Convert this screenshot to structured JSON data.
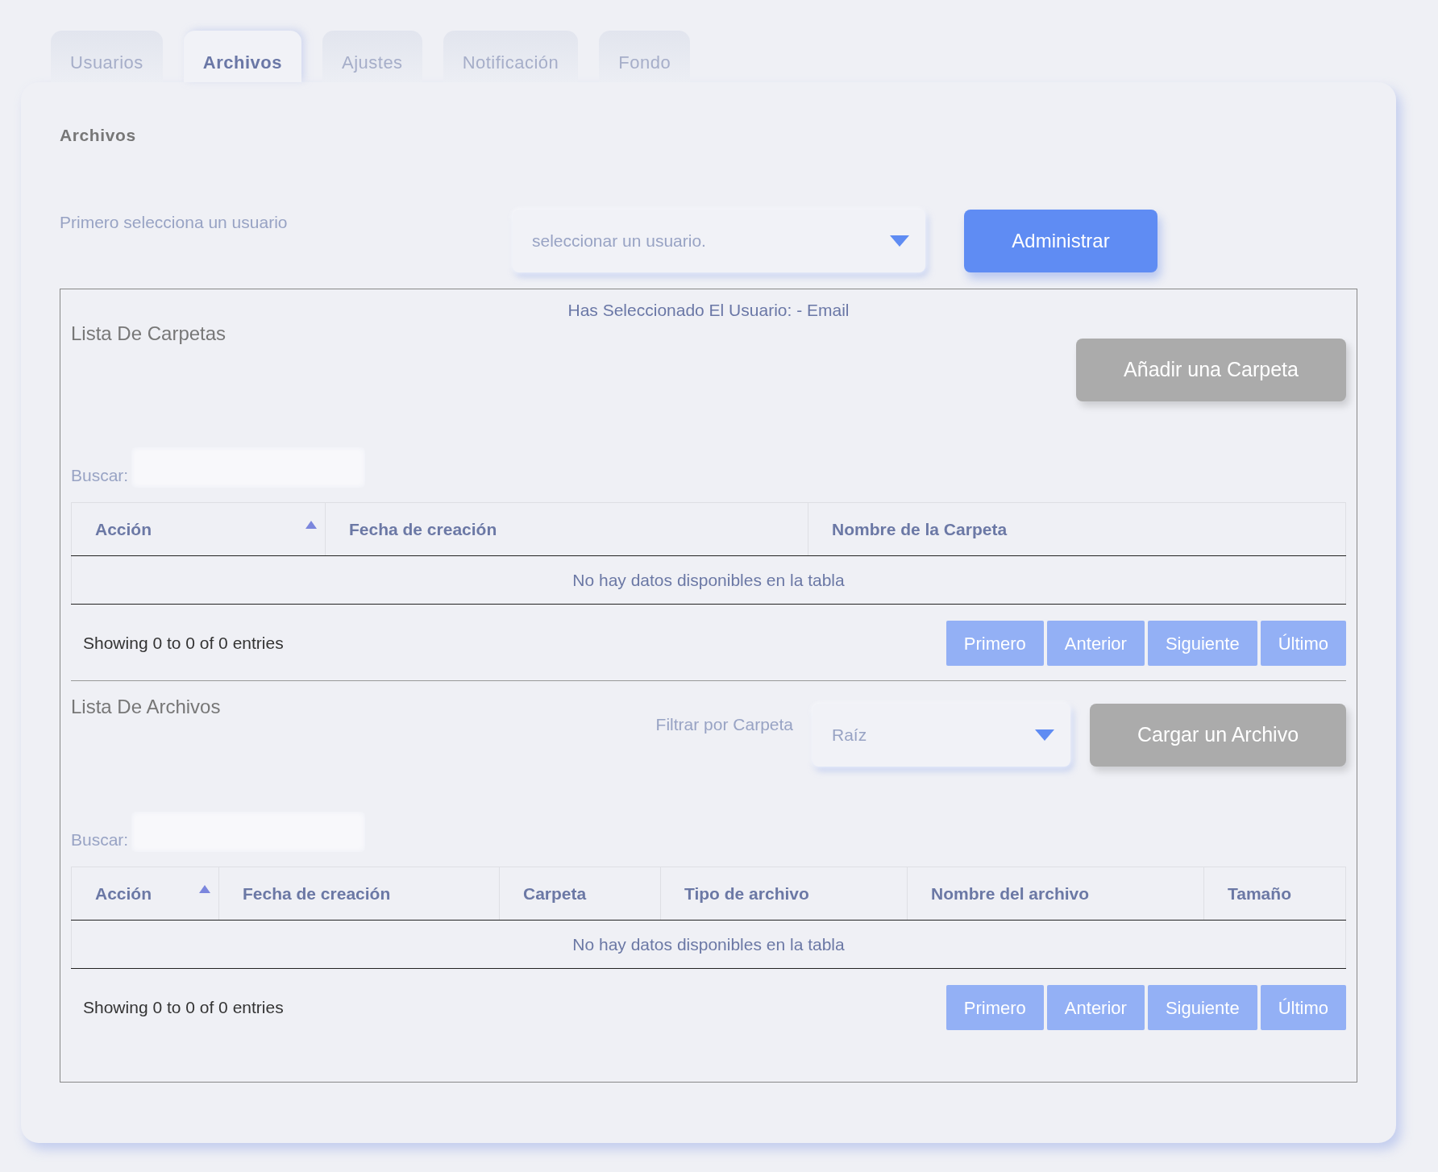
{
  "tabs": [
    {
      "label": "Usuarios",
      "selected": false
    },
    {
      "label": "Archivos",
      "selected": true
    },
    {
      "label": "Ajustes",
      "selected": false
    },
    {
      "label": "Notificación",
      "selected": false
    },
    {
      "label": "Fondo",
      "selected": false
    }
  ],
  "heading": "Archivos",
  "user_picker": {
    "label": "Primero selecciona un usuario",
    "select": {
      "value": "seleccionar un usuario."
    },
    "button": "Administrar"
  },
  "selected_user": "Has Seleccionado El Usuario: - Email",
  "folders": {
    "title": "Lista De Carpetas",
    "add_button": "Añadir una Carpeta",
    "search_label": "Buscar:",
    "table": {
      "columns": [
        {
          "label": "Acción",
          "sorted": true
        },
        {
          "label": "Fecha de creación",
          "sorted": false
        },
        {
          "label": "Nombre de la Carpeta",
          "sorted": false
        }
      ],
      "empty": "No hay datos disponibles en la tabla"
    },
    "info": "Showing 0 to 0 of 0 entries",
    "pagination": [
      "Primero",
      "Anterior",
      "Siguiente",
      "Último"
    ]
  },
  "files": {
    "title": "Lista De Archivos",
    "filter_label": "Filtrar por Carpeta",
    "filter": {
      "value": "Raíz"
    },
    "upload_button": "Cargar un Archivo",
    "search_label": "Buscar:",
    "table": {
      "columns": [
        {
          "label": "Acción",
          "sorted": true
        },
        {
          "label": "Fecha de creación",
          "sorted": false
        },
        {
          "label": "Carpeta",
          "sorted": false
        },
        {
          "label": "Tipo de archivo",
          "sorted": false
        },
        {
          "label": "Nombre del archivo",
          "sorted": false
        },
        {
          "label": "Tamaño",
          "sorted": false
        }
      ],
      "empty": "No hay datos disponibles en la tabla"
    },
    "info": "Showing 0 to 0 of 0 entries",
    "pagination": [
      "Primero",
      "Anterior",
      "Siguiente",
      "Último"
    ]
  }
}
